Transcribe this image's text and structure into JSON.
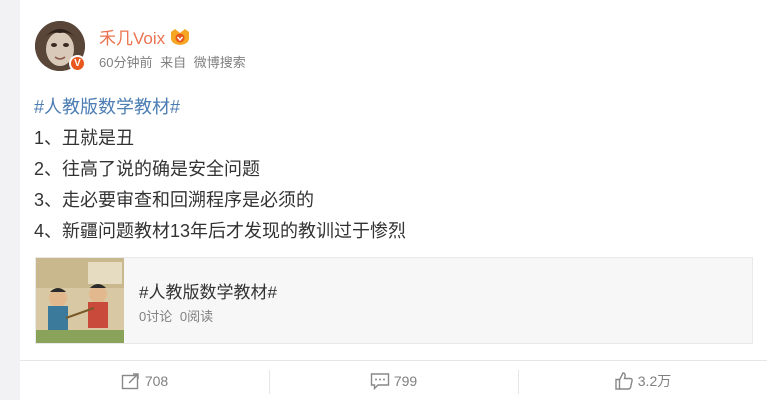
{
  "post": {
    "username": "禾几Voix",
    "time": "60分钟前",
    "source_prefix": "来自",
    "source": "微博搜索",
    "topic": "#人教版数学教材#",
    "lines": [
      "1、丑就是丑",
      "2、往高了说的确是安全问题",
      "3、走必要审查和回溯程序是必须的",
      "4、新疆问题教材13年后才发现的教训过于惨烈"
    ]
  },
  "topic_card": {
    "title": "#人教版数学教材#",
    "discussions": "0讨论",
    "reads": "0阅读"
  },
  "actions": {
    "forward_count": "708",
    "comment_count": "799",
    "like_count": "3.2万"
  },
  "colors": {
    "username": "#eb7350",
    "topic": "#4c7db3",
    "verified": "#e8581e"
  },
  "icons": {
    "forward": "forward-icon",
    "comment": "comment-icon",
    "like": "thumbs-up-icon",
    "verified": "verified-icon",
    "vip": "vip-badge-icon"
  }
}
